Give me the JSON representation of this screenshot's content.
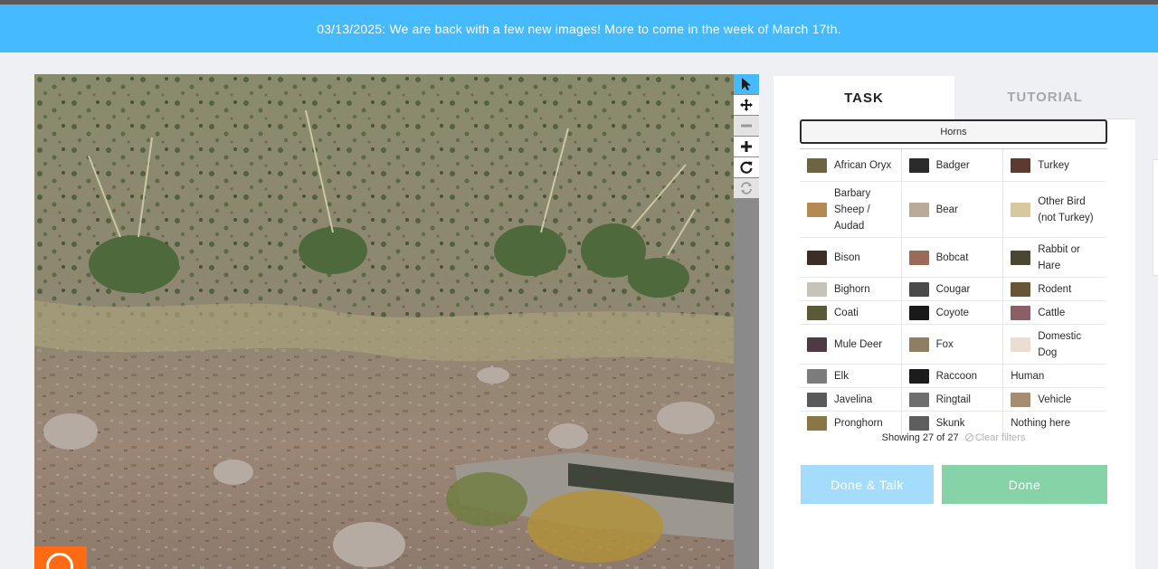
{
  "banner": {
    "text": "03/13/2025: We are back with a few new images! More to come in the week of March 17th."
  },
  "viewer": {
    "tools": [
      {
        "name": "pointer-icon",
        "state": "active"
      },
      {
        "name": "pan-icon",
        "state": "normal"
      },
      {
        "name": "zoom-out-icon",
        "state": "disabled"
      },
      {
        "name": "zoom-in-icon",
        "state": "normal"
      },
      {
        "name": "rotate-icon",
        "state": "normal"
      },
      {
        "name": "reset-icon",
        "state": "disabled"
      }
    ]
  },
  "task": {
    "tabs": {
      "task": "TASK",
      "tutorial": "TUTORIAL"
    },
    "filter_label": "Horns",
    "species": [
      [
        "African Oryx",
        "Badger",
        "Turkey"
      ],
      [
        "Barbary Sheep / Audad",
        "Bear",
        "Other Bird (not Turkey)"
      ],
      [
        "Bison",
        "Bobcat",
        "Rabbit or Hare"
      ],
      [
        "Bighorn",
        "Cougar",
        "Rodent"
      ],
      [
        "Coati",
        "Coyote",
        "Cattle"
      ],
      [
        "Mule Deer",
        "Fox",
        "Domestic Dog"
      ],
      [
        "Elk",
        "Raccoon",
        "Human"
      ],
      [
        "Javelina",
        "Ringtail",
        "Vehicle"
      ],
      [
        "Pronghorn",
        "Skunk",
        "Nothing here"
      ]
    ],
    "showing": "Showing 27 of 27",
    "clear_filters": "Clear filters",
    "done_talk": "Done & Talk",
    "done": "Done"
  },
  "colors": {
    "banner": "#45baff",
    "done_talk": "#a3dcfd",
    "done": "#86d3a8",
    "active_tool": "#45baff"
  }
}
